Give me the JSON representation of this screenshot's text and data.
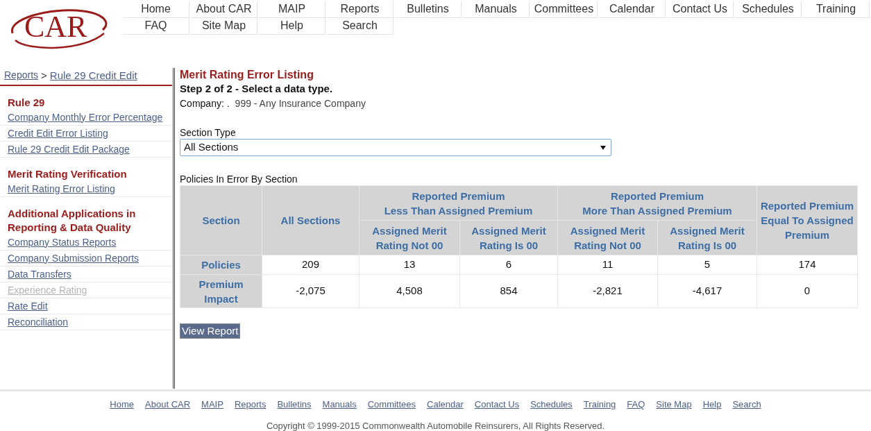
{
  "logo": {
    "text": "CAR"
  },
  "nav": {
    "rows": [
      [
        "Home",
        "About CAR",
        "MAIP",
        "Reports",
        "Bulletins",
        "Manuals",
        "Committees",
        "Calendar",
        "Contact Us",
        "Schedules",
        "Training"
      ],
      [
        "FAQ",
        "Site Map",
        "Help",
        "Search"
      ]
    ]
  },
  "breadcrumb": [
    "Reports",
    "Rule 29 Credit Edit"
  ],
  "breadcrumb_separator": ">",
  "sidebar": {
    "items": [
      {
        "kind": "heading",
        "label": "Rule 29"
      },
      {
        "kind": "link",
        "label": "Company Monthly Error Percentage",
        "disabled": false
      },
      {
        "kind": "link",
        "label": "Credit Edit Error Listing",
        "disabled": false
      },
      {
        "kind": "link",
        "label": "Rule 29 Credit Edit Package",
        "disabled": false
      },
      {
        "kind": "heading",
        "label": "Merit Rating Verification"
      },
      {
        "kind": "link",
        "label": "Merit Rating Error Listing",
        "disabled": false
      },
      {
        "kind": "heading",
        "label": "Additional Applications in Reporting & Data Quality"
      },
      {
        "kind": "link",
        "label": "Company Status Reports",
        "disabled": false
      },
      {
        "kind": "link",
        "label": "Company Submission Reports",
        "disabled": false
      },
      {
        "kind": "link",
        "label": "Data Transfers",
        "disabled": false
      },
      {
        "kind": "link",
        "label": "Experience Rating",
        "disabled": true
      },
      {
        "kind": "link",
        "label": "Rate Edit",
        "disabled": false
      },
      {
        "kind": "link",
        "label": "Reconciliation",
        "disabled": false
      }
    ]
  },
  "main": {
    "title": "Merit Rating Error Listing",
    "step": "Step 2 of 2 - Select a data type.",
    "company_label": "Company: .",
    "company_value": "999 - Any Insurance Company",
    "section_type": {
      "label": "Section Type",
      "value": "All Sections"
    },
    "table_caption": "Policies In Error By Section",
    "table": {
      "col_section": "Section",
      "col_all": "All Sections",
      "groups": [
        {
          "title": "Reported Premium\nLess Than Assigned Premium",
          "sub": [
            "Assigned Merit Rating Not 00",
            "Assigned Merit Rating Is 00"
          ]
        },
        {
          "title": "Reported Premium\nMore Than Assigned Premium",
          "sub": [
            "Assigned Merit Rating Not 00",
            "Assigned Merit Rating Is 00"
          ]
        }
      ],
      "col_equal": "Reported Premium Equal To Assigned Premium",
      "rows": [
        {
          "label": "Policies",
          "cells": [
            "209",
            "13",
            "6",
            "11",
            "5",
            "174"
          ]
        },
        {
          "label": "Premium Impact",
          "cells": [
            "-2,075",
            "4,508",
            "854",
            "-2,821",
            "-4,617",
            "0"
          ]
        }
      ]
    },
    "button": "View Report"
  },
  "footer": {
    "links": [
      "Home",
      "About CAR",
      "MAIP",
      "Reports",
      "Bulletins",
      "Manuals",
      "Committees",
      "Calendar",
      "Contact Us",
      "Schedules",
      "Training",
      "FAQ",
      "Site Map",
      "Help",
      "Search"
    ],
    "copyright": "Copyright © 1999-2015 Commonwealth Automobile Reinsurers, All Rights Reserved."
  }
}
